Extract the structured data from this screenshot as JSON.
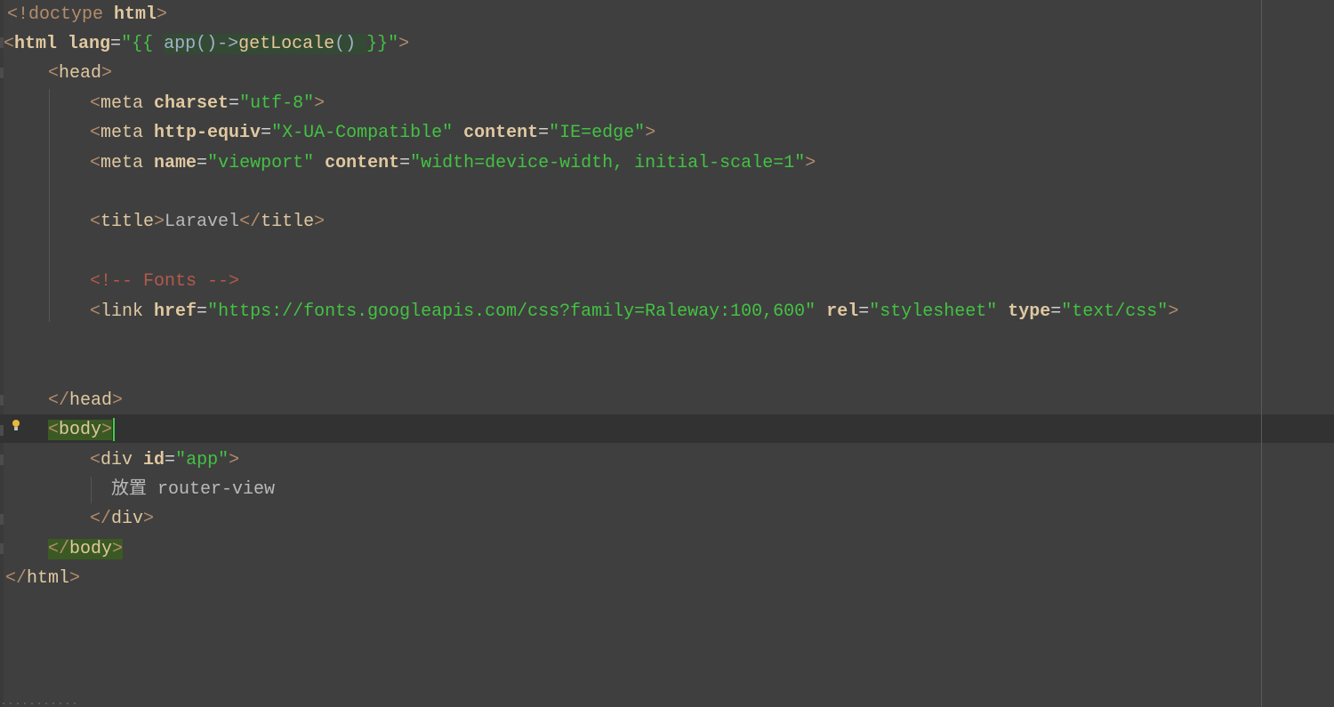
{
  "editor": {
    "lines": [
      {
        "parts": [
          "<!doctype ",
          "html",
          ">"
        ]
      },
      {
        "parts": [
          "<",
          "html",
          " lang",
          "=",
          "\"{{ ",
          "app()->",
          "getLocale",
          "() ",
          "}}\"",
          ">"
        ]
      },
      {
        "parts": [
          "<",
          "head",
          ">"
        ]
      },
      {
        "parts": [
          "<",
          "meta",
          " charset",
          "=",
          "\"utf-8\"",
          ">"
        ]
      },
      {
        "parts": [
          "<",
          "meta",
          " http-equiv",
          "=",
          "\"X-UA-Compatible\"",
          " content",
          "=",
          "\"IE=edge\"",
          ">"
        ]
      },
      {
        "parts": [
          "<",
          "meta",
          " name",
          "=",
          "\"viewport\"",
          " content",
          "=",
          "\"width=device-width, initial-scale=1\"",
          ">"
        ]
      },
      {
        "parts": [
          "<",
          "title",
          ">",
          "Laravel",
          "</",
          "title",
          ">"
        ]
      },
      {
        "parts": [
          "<!-- Fonts -->"
        ]
      },
      {
        "parts": [
          "<",
          "link",
          " href",
          "=",
          "\"https://fonts.googleapis.com/css?family=Raleway:100,600\"",
          " rel",
          "=",
          "\"stylesheet\"",
          " type",
          "=",
          "\"text/css\"",
          ">"
        ]
      },
      {
        "parts": [
          "</",
          "head",
          ">"
        ]
      },
      {
        "parts": [
          "<",
          "body",
          ">"
        ]
      },
      {
        "parts": [
          "<",
          "div",
          " id",
          "=",
          "\"app\"",
          ">"
        ]
      },
      {
        "parts": [
          "放置 router-view"
        ]
      },
      {
        "parts": [
          "</",
          "div",
          ">"
        ]
      },
      {
        "parts": [
          "</",
          "body",
          ">"
        ]
      },
      {
        "parts": [
          "</",
          "html",
          ">"
        ]
      }
    ]
  },
  "icons": {
    "intention": "bulb-icon"
  },
  "colors": {
    "background": "#3f3f3f",
    "string": "#43c243",
    "tag_name": "#e0c8a0",
    "comment": "#b25a4a",
    "match_highlight": "#3b5a23",
    "caret": "#40d040"
  }
}
